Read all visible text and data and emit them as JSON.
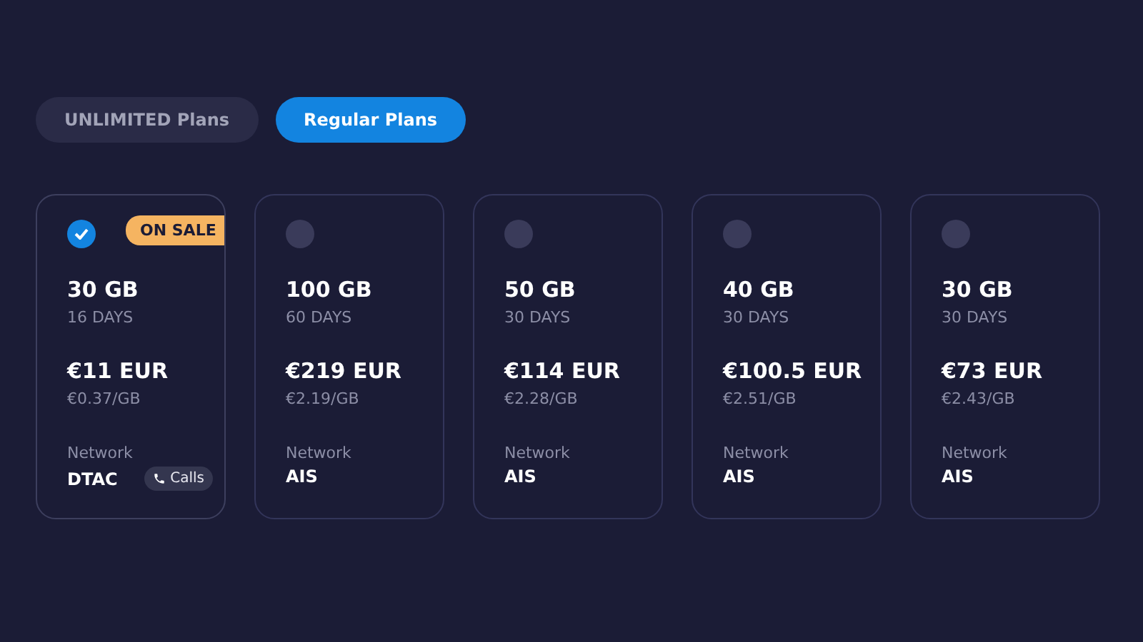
{
  "tabs": [
    {
      "label": "UNLIMITED Plans",
      "selected": false
    },
    {
      "label": "Regular Plans",
      "selected": true
    }
  ],
  "plans": [
    {
      "selected": true,
      "badge": "ON SALE",
      "data": "30 GB",
      "days": "16 DAYS",
      "price": "€11 EUR",
      "per_gb": "€0.37/GB",
      "network_label": "Network",
      "network": "DTAC",
      "feature": "Calls"
    },
    {
      "selected": false,
      "data": "100 GB",
      "days": "60 DAYS",
      "price": "€219 EUR",
      "per_gb": "€2.19/GB",
      "network_label": "Network",
      "network": "AIS"
    },
    {
      "selected": false,
      "data": "50 GB",
      "days": "30 DAYS",
      "price": "€114 EUR",
      "per_gb": "€2.28/GB",
      "network_label": "Network",
      "network": "AIS"
    },
    {
      "selected": false,
      "data": "40 GB",
      "days": "30 DAYS",
      "price": "€100.5 EUR",
      "per_gb": "€2.51/GB",
      "network_label": "Network",
      "network": "AIS"
    },
    {
      "selected": false,
      "data": "30 GB",
      "days": "30 DAYS",
      "price": "€73 EUR",
      "per_gb": "€2.43/GB",
      "network_label": "Network",
      "network": "AIS"
    }
  ]
}
